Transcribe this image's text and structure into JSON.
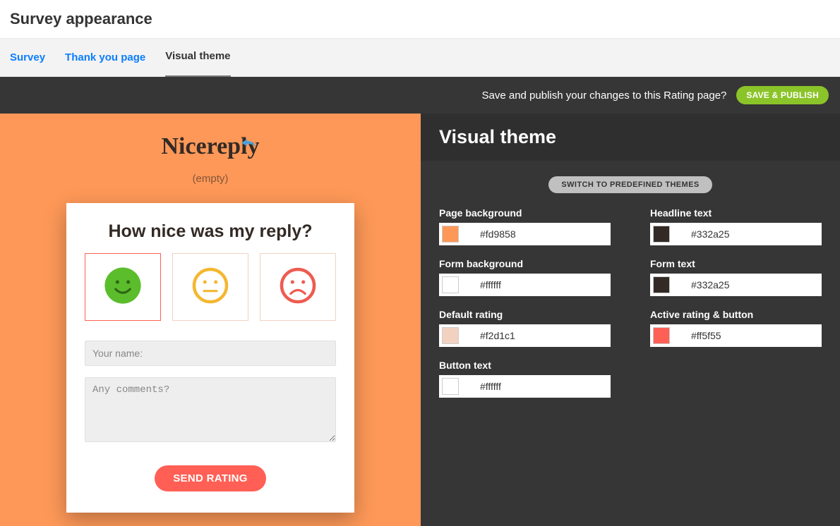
{
  "header": {
    "title": "Survey appearance"
  },
  "tabs": [
    {
      "label": "Survey",
      "kind": "link"
    },
    {
      "label": "Thank you page",
      "kind": "link"
    },
    {
      "label": "Visual theme",
      "kind": "active"
    }
  ],
  "action_bar": {
    "prompt": "Save and publish your changes to this Rating page?",
    "save_label": "SAVE & PUBLISH"
  },
  "preview": {
    "logo_text": "Nicereply",
    "empty_label": "(empty)",
    "question": "How nice was my reply?",
    "name_placeholder": "Your name:",
    "comments_placeholder": "Any comments?",
    "send_label": "SEND RATING",
    "faces": [
      {
        "name": "smile",
        "active": true
      },
      {
        "name": "neutral",
        "active": false
      },
      {
        "name": "frown",
        "active": false
      }
    ]
  },
  "theme_panel": {
    "title": "Visual theme",
    "switch_label": "SWITCH TO PREDEFINED THEMES",
    "colors": {
      "page_background": {
        "label": "Page background",
        "value": "#fd9858"
      },
      "headline_text": {
        "label": "Headline text",
        "value": "#332a25"
      },
      "form_background": {
        "label": "Form background",
        "value": "#ffffff"
      },
      "form_text": {
        "label": "Form text",
        "value": "#332a25"
      },
      "default_rating": {
        "label": "Default rating",
        "value": "#f2d1c1"
      },
      "active_rating_button": {
        "label": "Active rating & button",
        "value": "#ff5f55"
      },
      "button_text": {
        "label": "Button text",
        "value": "#ffffff"
      }
    }
  }
}
